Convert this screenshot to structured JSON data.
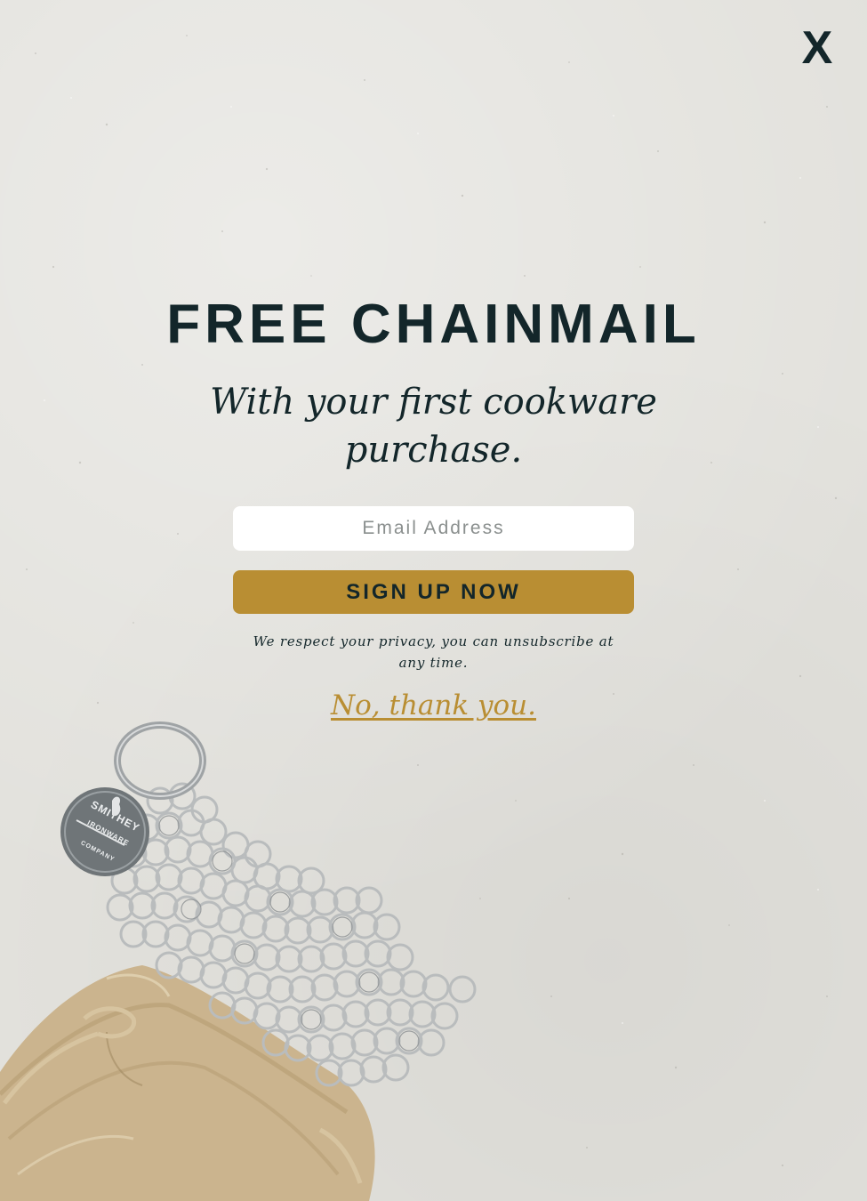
{
  "popup": {
    "close_label": "X",
    "headline": "FREE CHAINMAIL",
    "subhead": "With your first cookware purchase.",
    "email": {
      "placeholder": "Email Address",
      "value": ""
    },
    "signup_label": "SIGN UP NOW",
    "privacy_text": "We respect your privacy, you can unsubscribe at any time.",
    "decline_label": "No, thank you."
  },
  "colors": {
    "background": "#e2e1dc",
    "text_dark": "#13262a",
    "accent_gold": "#b98e33",
    "input_bg": "#ffffff"
  },
  "image": {
    "tag_lettering": [
      "SMITHEY",
      "IRONWARE",
      "COMPANY"
    ]
  }
}
